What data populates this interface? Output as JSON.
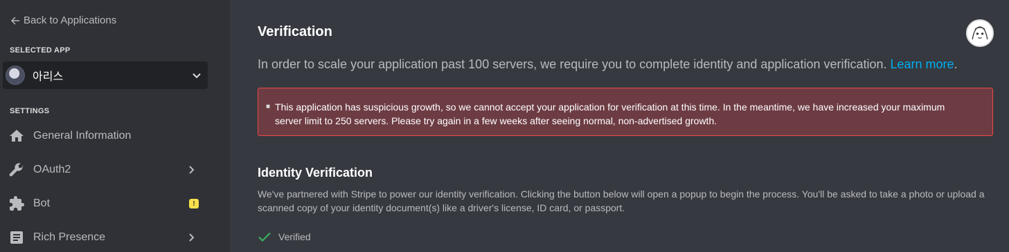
{
  "sidebar": {
    "back_label": "Back to Applications",
    "selected_app_header": "SELECTED APP",
    "selected_app_name": "아리스",
    "settings_header": "SETTINGS",
    "items": [
      {
        "label": "General Information",
        "icon": "home-icon"
      },
      {
        "label": "OAuth2",
        "icon": "wrench-icon"
      },
      {
        "label": "Bot",
        "icon": "puzzle-icon",
        "badge": "!"
      },
      {
        "label": "Rich Presence",
        "icon": "document-icon"
      }
    ]
  },
  "main": {
    "title": "Verification",
    "intro_text": "In order to scale your application past 100 servers, we require you to complete identity and application verification.",
    "intro_link": "Learn more",
    "intro_end": ".",
    "error_message": "This application has suspicious growth, so we cannot accept your application for verification at this time. In the meantime, we have increased your maximum server limit to 250 servers. Please try again in a few weeks after seeing normal, non-advertised growth.",
    "identity": {
      "title": "Identity Verification",
      "description": "We've partnered with Stripe to power our identity verification. Clicking the button below will open a popup to begin the process. You'll be asked to take a photo or upload a scanned copy of your identity document(s) like a driver's license, ID card, or passport.",
      "status": "Verified"
    }
  },
  "colors": {
    "sidebar_bg": "#2f3136",
    "main_bg": "#36393f",
    "link": "#00aff4",
    "error_bg": "#6d3c43",
    "error_border": "#f04747",
    "success": "#3ba55c",
    "warning": "#f9e04a"
  }
}
